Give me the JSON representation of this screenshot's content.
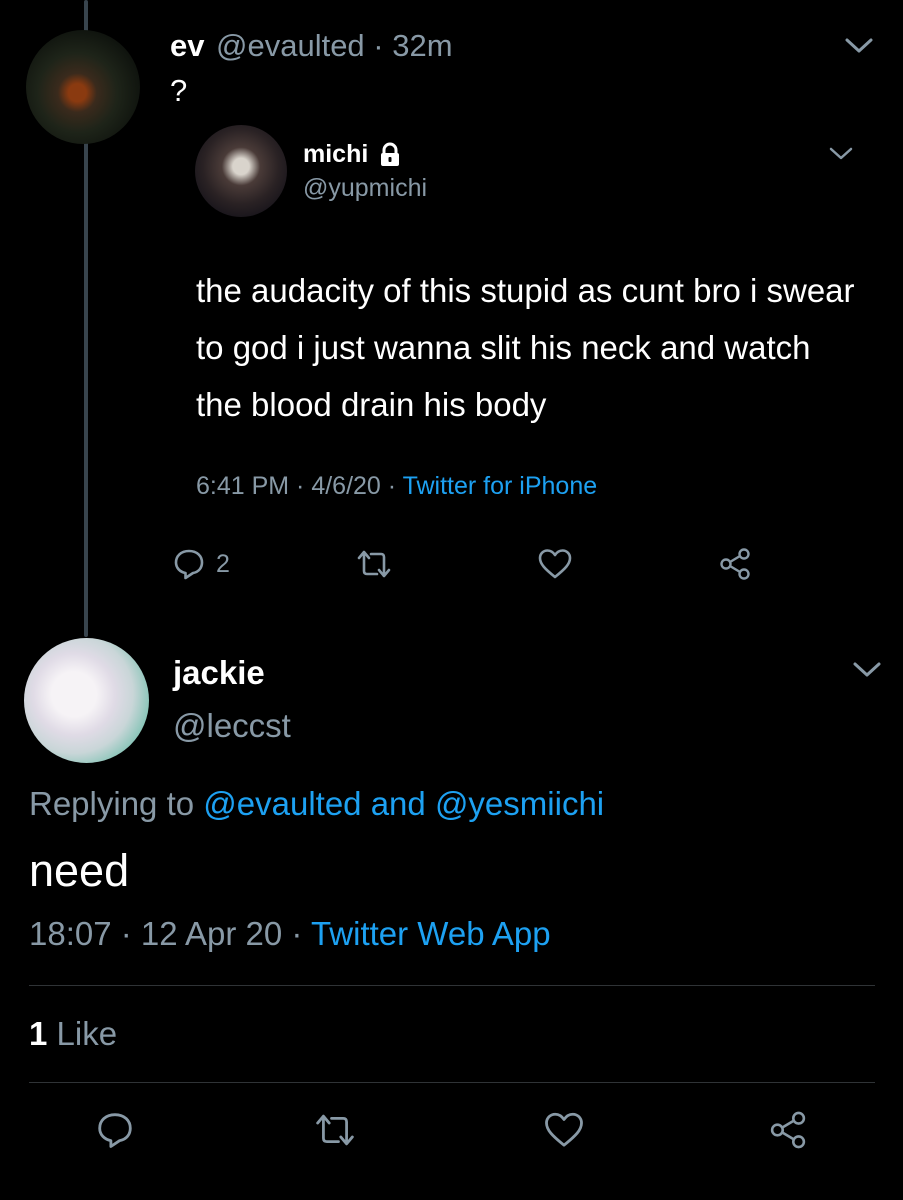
{
  "parent_tweet": {
    "name": "ev",
    "handle": "@evaulted",
    "time": "32m",
    "separator": " · ",
    "text": "?"
  },
  "quoted_tweet": {
    "name": "michi",
    "handle": "@yupmichi",
    "text": "the audacity of this stupid as cunt bro i swear to god i just wanna slit his neck and watch the blood drain his body",
    "time": "6:41 PM",
    "date": "4/6/20",
    "source": "Twitter for iPhone",
    "separator": " · ",
    "reply_count": "2",
    "locked_icon": "lock-icon"
  },
  "main_tweet": {
    "name": "jackie",
    "handle": "@leccst",
    "replying_prefix": "Replying to ",
    "replying_user1": "@evaulted",
    "replying_and": " and ",
    "replying_user2": "@yesmiichi",
    "text": "need",
    "time": "18:07",
    "date": "12 Apr 20",
    "source": "Twitter Web App",
    "separator": " · ",
    "like_count": "1",
    "like_label": " Like"
  },
  "colors": {
    "background": "#000000",
    "secondary_text": "#8899a6",
    "link": "#1da1f2",
    "divider": "#2f3336"
  }
}
